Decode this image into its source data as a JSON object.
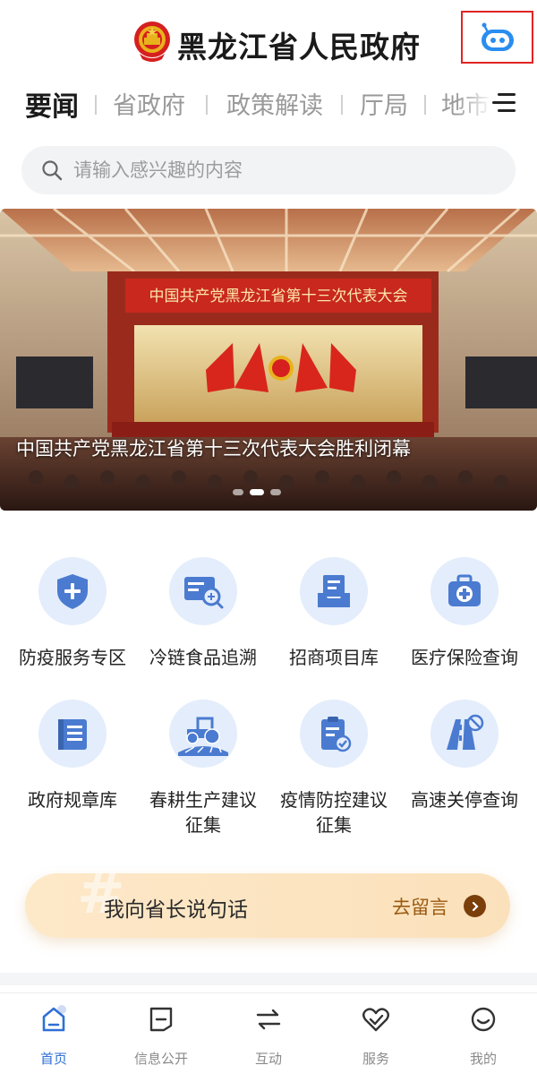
{
  "header": {
    "title": "黑龙江省人民政府",
    "emblem_icon": "national-emblem-icon",
    "assistant_icon": "robot-assistant-icon"
  },
  "tabs": [
    {
      "label": "要闻",
      "active": true
    },
    {
      "label": "省政府",
      "active": false
    },
    {
      "label": "政策解读",
      "active": false
    },
    {
      "label": "厅局",
      "active": false
    },
    {
      "label": "地市",
      "active": false
    }
  ],
  "search": {
    "placeholder": "请输入感兴趣的内容"
  },
  "banner": {
    "caption": "中国共产党黑龙江省第十三次代表大会胜利闭幕",
    "stage_banner_text": "中国共产党黑龙江省第十三次代表大会",
    "slide_count": 3,
    "active_slide": 2
  },
  "services": [
    {
      "label": "防疫服务专区",
      "icon": "shield-plus-icon"
    },
    {
      "label": "冷链食品追溯",
      "icon": "cold-chain-search-icon"
    },
    {
      "label": "招商项目库",
      "icon": "project-tray-icon"
    },
    {
      "label": "医疗保险查询",
      "icon": "medical-kit-icon"
    },
    {
      "label": "政府规章库",
      "icon": "regulation-book-icon"
    },
    {
      "label": "春耕生产建议征集",
      "icon": "tractor-icon"
    },
    {
      "label": "疫情防控建议征集",
      "icon": "clipboard-check-icon"
    },
    {
      "label": "高速关停查询",
      "icon": "highway-closed-icon"
    }
  ],
  "governor_message": {
    "title": "我向省长说句话",
    "action": "去留言"
  },
  "bottom_nav": [
    {
      "label": "首页",
      "icon": "home-icon",
      "active": true
    },
    {
      "label": "信息公开",
      "icon": "info-open-icon",
      "active": false
    },
    {
      "label": "互动",
      "icon": "interact-arrows-icon",
      "active": false
    },
    {
      "label": "服务",
      "icon": "heart-check-icon",
      "active": false
    },
    {
      "label": "我的",
      "icon": "smile-face-icon",
      "active": false
    }
  ],
  "colors": {
    "accent_blue": "#2f6fd6",
    "icon_blue": "#4a7bd0",
    "icon_bg": "#e4edfb",
    "gov_bar_bg": "#fde8c8",
    "gov_action_text": "#9a5a12",
    "assistant_outline": "#e02424"
  }
}
